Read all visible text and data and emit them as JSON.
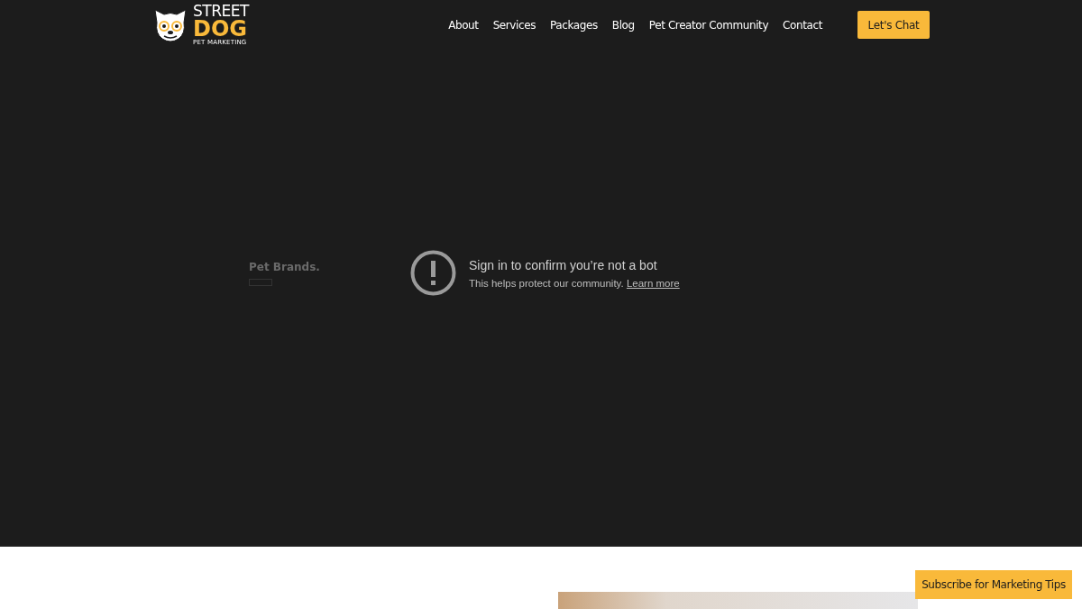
{
  "logo": {
    "line_1": "STREET",
    "line_2": "DOG",
    "tagline": "PET MARKETING"
  },
  "nav": {
    "links": [
      "About",
      "Services",
      "Packages",
      "Blog",
      "Pet Creator Community",
      "Contact"
    ],
    "cta": "Let's Chat"
  },
  "video": {
    "background_text": "Pet Brands.",
    "error_title": "Sign in to confirm you’re not a bot",
    "error_message": "This helps protect our community.",
    "error_link": "Learn more"
  },
  "subscribe_button": "Subscribe for Marketing Tips"
}
